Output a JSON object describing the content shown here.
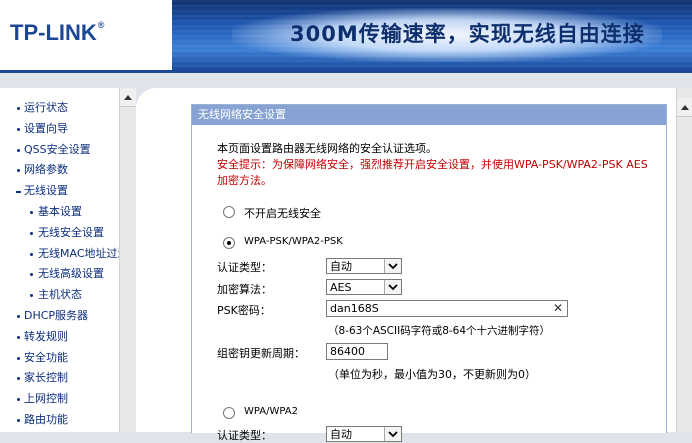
{
  "header": {
    "logo": "TP-LINK",
    "logo_mark": "®",
    "banner_text": "300M传输速率，实现无线自由连接"
  },
  "sidebar": {
    "items": [
      {
        "label": "运行状态",
        "level": "top"
      },
      {
        "label": "设置向导",
        "level": "top"
      },
      {
        "label": "QSS安全设置",
        "level": "top"
      },
      {
        "label": "网络参数",
        "level": "top"
      },
      {
        "label": "无线设置",
        "level": "top-open"
      },
      {
        "label": "基本设置",
        "level": "sub"
      },
      {
        "label": "无线安全设置",
        "level": "sub"
      },
      {
        "label": "无线MAC地址过滤",
        "level": "sub"
      },
      {
        "label": "无线高级设置",
        "level": "sub"
      },
      {
        "label": "主机状态",
        "level": "sub"
      },
      {
        "label": "DHCP服务器",
        "level": "top"
      },
      {
        "label": "转发规则",
        "level": "top"
      },
      {
        "label": "安全功能",
        "level": "top"
      },
      {
        "label": "家长控制",
        "level": "top"
      },
      {
        "label": "上网控制",
        "level": "top"
      },
      {
        "label": "路由功能",
        "level": "top"
      }
    ]
  },
  "content": {
    "title": "无线网络安全设置",
    "intro": "本页面设置路由器无线网络的安全认证选项。",
    "warning_line1": "安全提示：为保障网络安全，强烈推荐开启安全设置，并使用WPA-PSK/WPA2-PSK AES",
    "warning_line2": "加密方法。",
    "option_off": "不开启无线安全",
    "option_wpa_psk": "WPA-PSK/WPA2-PSK",
    "auth_type_label": "认证类型：",
    "auth_type_value": "自动",
    "encryption_label": "加密算法：",
    "encryption_value": "AES",
    "psk_label": "PSK密码：",
    "psk_value": "dan168S",
    "psk_hint": "（8-63个ASCII码字符或8-64个十六进制字符）",
    "renew_label": "组密钥更新周期：",
    "renew_value": "86400",
    "renew_hint": "（单位为秒，最小值为30，不更新则为0）",
    "option_wpa": "WPA/WPA2",
    "auth_type2_label": "认证类型：",
    "auth_type2_value": "自动"
  }
}
